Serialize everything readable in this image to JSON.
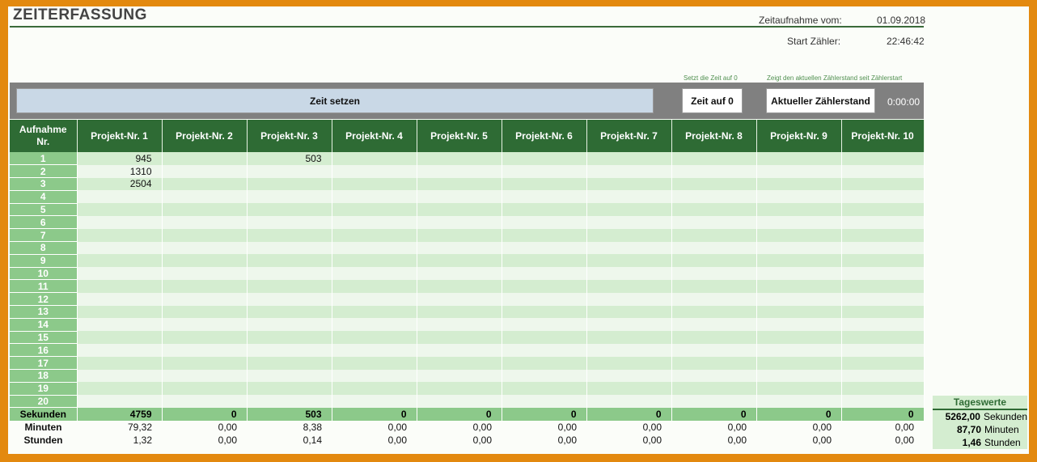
{
  "header": {
    "title": "ZEITERFASSUNG",
    "date_label": "Zeitaufnahme vom:",
    "date_value": "01.09.2018",
    "start_label": "Start Zähler:",
    "start_value": "22:46:42"
  },
  "hints": {
    "reset": "Setzt die Zeit auf 0",
    "current": "Zeigt den aktuellen Zählerstand seit Zählerstart"
  },
  "buttons": {
    "set_time": "Zeit setzen",
    "reset_time": "Zeit auf 0",
    "current_count": "Aktueller Zählerstand",
    "counter_value": "0:00:00"
  },
  "table": {
    "row_header": "Aufnahme Nr.",
    "columns": [
      "Projekt-Nr. 1",
      "Projekt-Nr. 2",
      "Projekt-Nr. 3",
      "Projekt-Nr. 4",
      "Projekt-Nr. 5",
      "Projekt-Nr. 6",
      "Projekt-Nr. 7",
      "Projekt-Nr. 8",
      "Projekt-Nr. 9",
      "Projekt-Nr. 10"
    ],
    "rows": [
      [
        "945",
        "",
        "503",
        "",
        "",
        "",
        "",
        "",
        "",
        ""
      ],
      [
        "1310",
        "",
        "",
        "",
        "",
        "",
        "",
        "",
        "",
        ""
      ],
      [
        "2504",
        "",
        "",
        "",
        "",
        "",
        "",
        "",
        "",
        ""
      ],
      [
        "",
        "",
        "",
        "",
        "",
        "",
        "",
        "",
        "",
        ""
      ],
      [
        "",
        "",
        "",
        "",
        "",
        "",
        "",
        "",
        "",
        ""
      ],
      [
        "",
        "",
        "",
        "",
        "",
        "",
        "",
        "",
        "",
        ""
      ],
      [
        "",
        "",
        "",
        "",
        "",
        "",
        "",
        "",
        "",
        ""
      ],
      [
        "",
        "",
        "",
        "",
        "",
        "",
        "",
        "",
        "",
        ""
      ],
      [
        "",
        "",
        "",
        "",
        "",
        "",
        "",
        "",
        "",
        ""
      ],
      [
        "",
        "",
        "",
        "",
        "",
        "",
        "",
        "",
        "",
        ""
      ],
      [
        "",
        "",
        "",
        "",
        "",
        "",
        "",
        "",
        "",
        ""
      ],
      [
        "",
        "",
        "",
        "",
        "",
        "",
        "",
        "",
        "",
        ""
      ],
      [
        "",
        "",
        "",
        "",
        "",
        "",
        "",
        "",
        "",
        ""
      ],
      [
        "",
        "",
        "",
        "",
        "",
        "",
        "",
        "",
        "",
        ""
      ],
      [
        "",
        "",
        "",
        "",
        "",
        "",
        "",
        "",
        "",
        ""
      ],
      [
        "",
        "",
        "",
        "",
        "",
        "",
        "",
        "",
        "",
        ""
      ],
      [
        "",
        "",
        "",
        "",
        "",
        "",
        "",
        "",
        "",
        ""
      ],
      [
        "",
        "",
        "",
        "",
        "",
        "",
        "",
        "",
        "",
        ""
      ],
      [
        "",
        "",
        "",
        "",
        "",
        "",
        "",
        "",
        "",
        ""
      ],
      [
        "",
        "",
        "",
        "",
        "",
        "",
        "",
        "",
        "",
        ""
      ]
    ],
    "row_numbers": [
      "1",
      "2",
      "3",
      "4",
      "5",
      "6",
      "7",
      "8",
      "9",
      "10",
      "11",
      "12",
      "13",
      "14",
      "15",
      "16",
      "17",
      "18",
      "19",
      "20"
    ],
    "sekunden_label": "Sekunden",
    "sekunden": [
      "4759",
      "0",
      "503",
      "0",
      "0",
      "0",
      "0",
      "0",
      "0",
      "0"
    ],
    "minuten_label": "Minuten",
    "minuten": [
      "79,32",
      "0,00",
      "8,38",
      "0,00",
      "0,00",
      "0,00",
      "0,00",
      "0,00",
      "0,00",
      "0,00"
    ],
    "stunden_label": "Stunden",
    "stunden": [
      "1,32",
      "0,00",
      "0,14",
      "0,00",
      "0,00",
      "0,00",
      "0,00",
      "0,00",
      "0,00",
      "0,00"
    ]
  },
  "tageswerte": {
    "title": "Tageswerte",
    "sekunden_value": "5262,00",
    "sekunden_unit": "Sekunden",
    "minuten_value": "87,70",
    "minuten_unit": "Minuten",
    "stunden_value": "1,46",
    "stunden_unit": "Stunden"
  }
}
